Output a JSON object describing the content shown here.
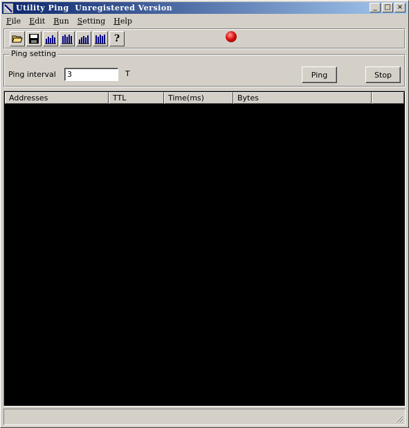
{
  "window": {
    "title": "Utility Ping  Unregistered Version",
    "minimize_glyph": "_",
    "maximize_glyph": "□",
    "close_glyph": "×"
  },
  "menu": [
    {
      "label_ul": "F",
      "label_rest": "ile"
    },
    {
      "label_ul": "E",
      "label_rest": "dit"
    },
    {
      "label_ul": "R",
      "label_rest": "un"
    },
    {
      "label_ul": "S",
      "label_rest": "etting"
    },
    {
      "label_ul": "H",
      "label_rest": "elp"
    }
  ],
  "toolbar": {
    "icons": [
      "open-folder-icon",
      "save-disk-icon",
      "ping-chart-icon",
      "ping-all-chart-icon",
      "trace-chart-icon",
      "stats-chart-icon",
      "help-question-icon"
    ],
    "help_glyph": "?",
    "status_light_color": "#e01010"
  },
  "ping_setting": {
    "legend": "Ping setting",
    "interval_label": "Ping interval",
    "interval_value": "3",
    "unit_label": "T",
    "ping_button": "Ping",
    "stop_button": "Stop"
  },
  "results": {
    "columns": [
      "Addresses",
      "TTL",
      "Time(ms)",
      "Bytes"
    ],
    "rows": []
  },
  "statusbar": {
    "text": ""
  }
}
